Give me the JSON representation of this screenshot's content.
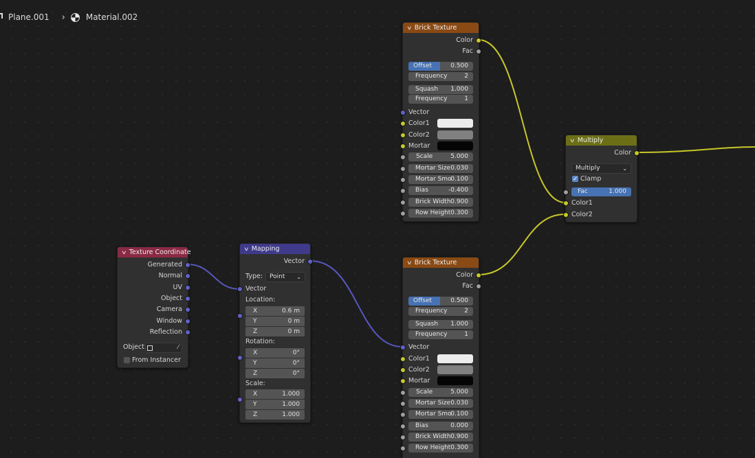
{
  "breadcrumb": {
    "object": "Plane.001",
    "material": "Material.002"
  },
  "colors": {
    "color1": "#ececec",
    "color2": "#808080",
    "mortar": "#050505"
  },
  "brick_top": {
    "title": "Brick Texture",
    "out_color": "Color",
    "out_fac": "Fac",
    "offset_label": "Offset",
    "offset": "0.500",
    "freq1_label": "Frequency",
    "freq1": "2",
    "squash_label": "Squash",
    "squash": "1.000",
    "freq2_label": "Frequency",
    "freq2": "1",
    "vector_label": "Vector",
    "color1_label": "Color1",
    "color2_label": "Color2",
    "mortar_label": "Mortar",
    "scale_label": "Scale",
    "scale": "5.000",
    "mortar_size_label": "Mortar Size",
    "mortar_size": "0.030",
    "mortar_smooth_label": "Mortar Smo",
    "mortar_smooth": "0.100",
    "bias_label": "Bias",
    "bias": "-0.400",
    "brick_width_label": "Brick Width",
    "brick_width": "0.900",
    "row_height_label": "Row Height",
    "row_height": "0.300"
  },
  "brick_bottom": {
    "title": "Brick Texture",
    "out_color": "Color",
    "out_fac": "Fac",
    "offset_label": "Offset",
    "offset": "0.500",
    "freq1_label": "Frequency",
    "freq1": "2",
    "squash_label": "Squash",
    "squash": "1.000",
    "freq2_label": "Frequency",
    "freq2": "1",
    "vector_label": "Vector",
    "color1_label": "Color1",
    "color2_label": "Color2",
    "mortar_label": "Mortar",
    "scale_label": "Scale",
    "scale": "5.000",
    "mortar_size_label": "Mortar Size",
    "mortar_size": "0.030",
    "mortar_smooth_label": "Mortar Smo",
    "mortar_smooth": "0.100",
    "bias_label": "Bias",
    "bias": "0.000",
    "brick_width_label": "Brick Width",
    "brick_width": "0.900",
    "row_height_label": "Row Height",
    "row_height": "0.300"
  },
  "multiply": {
    "title": "Multiply",
    "out_color": "Color",
    "blend": "Multiply",
    "clamp_label": "Clamp",
    "fac_label": "Fac",
    "fac": "1.000",
    "color1_label": "Color1",
    "color2_label": "Color2"
  },
  "texcoord": {
    "title": "Texture Coordinate",
    "outputs": [
      "Generated",
      "Normal",
      "UV",
      "Object",
      "Camera",
      "Window",
      "Reflection"
    ],
    "object_label": "Object:",
    "from_instancer": "From Instancer"
  },
  "mapping": {
    "title": "Mapping",
    "out_vector": "Vector",
    "type_label": "Type:",
    "type": "Point",
    "vector_label": "Vector",
    "location_label": "Location:",
    "location": [
      {
        "axis": "X",
        "value": "0.6 m"
      },
      {
        "axis": "Y",
        "value": "0 m"
      },
      {
        "axis": "Z",
        "value": "0 m"
      }
    ],
    "rotation_label": "Rotation:",
    "rotation": [
      {
        "axis": "X",
        "value": "0°"
      },
      {
        "axis": "Y",
        "value": "0°"
      },
      {
        "axis": "Z",
        "value": "0°"
      }
    ],
    "scale_label": "Scale:",
    "scale": [
      {
        "axis": "X",
        "value": "1.000"
      },
      {
        "axis": "Y",
        "value": "1.000"
      },
      {
        "axis": "Z",
        "value": "1.000"
      }
    ]
  }
}
